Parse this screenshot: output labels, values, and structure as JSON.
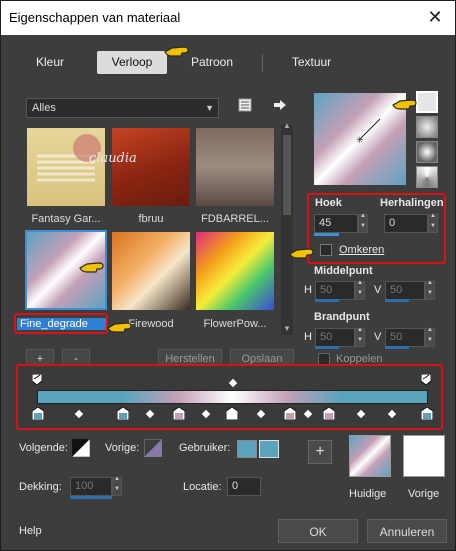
{
  "window": {
    "title": "Eigenschappen van materiaal",
    "close": "✕"
  },
  "tabs": [
    {
      "label": "Kleur"
    },
    {
      "label": "Verloop"
    },
    {
      "label": "Patroon"
    },
    {
      "label": "Textuur"
    }
  ],
  "library": {
    "dropdown_value": "Alles",
    "items": [
      {
        "label": "Fantasy Gar..."
      },
      {
        "label": "fbruu"
      },
      {
        "label": "FDBARREL..."
      },
      {
        "label": "Fine_degrade"
      },
      {
        "label": "Firewood"
      },
      {
        "label": "FlowerPow..."
      }
    ],
    "add_label": "+",
    "remove_label": "-",
    "restore_label": "Herstellen",
    "save_label": "Opslaan",
    "thumb_watermark": "claudia"
  },
  "angle": {
    "label": "Hoek",
    "value": "45"
  },
  "repeats": {
    "label": "Herhalingen",
    "value": "0"
  },
  "invert": {
    "label": "Omkeren"
  },
  "center": {
    "label": "Middelpunt",
    "h_label": "H",
    "h_value": "50",
    "v_label": "V",
    "v_value": "50"
  },
  "focal": {
    "label": "Brandpunt",
    "h_label": "H",
    "h_value": "50",
    "v_label": "V",
    "v_value": "50"
  },
  "link": {
    "label": "Koppelen"
  },
  "editor": {
    "next_label": "Volgende:",
    "prev_label": "Vorige:",
    "user_label": "Gebruiker:",
    "user_color": "#5aa3bd",
    "opacity_label": "Dekking:",
    "opacity_value": "100",
    "location_label": "Locatie:",
    "location_value": "0"
  },
  "swatches": {
    "add": "+",
    "current_label": "Huidige",
    "previous_label": "Vorige"
  },
  "footer": {
    "help": "Help",
    "ok": "OK",
    "cancel": "Annuleren"
  },
  "colors": {
    "accent": "#3c8ed6",
    "highlight": "#d11111",
    "teal": "#5aa3bd",
    "pink": "#c4a0b8"
  }
}
